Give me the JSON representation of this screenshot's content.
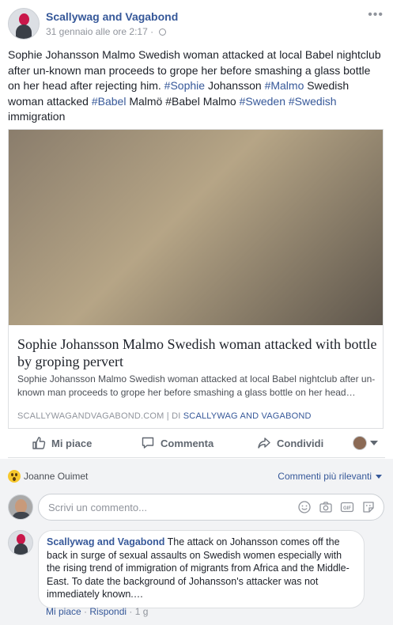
{
  "post": {
    "page_name": "Scallywag and Vagabond",
    "timestamp": "31 gennaio alle ore 2:17",
    "separator": "·",
    "more": "•••",
    "text": {
      "t1": "Sophie Johansson Malmo Swedish woman attacked at local Babel nightclub after un-known man proceeds to grope her before smashing a glass bottle on her head after rejecting him. ",
      "h1": "#Sophie",
      "t2": " Johansson ",
      "h2": "#Malmo",
      "t3": " Swedish woman attacked ",
      "h3": "#Babel",
      "t4": " Malmö #Babel Malmo ",
      "h4": "#Sweden",
      "t5": " ",
      "h5": "#Swedish",
      "t6": " immigration"
    }
  },
  "link_card": {
    "title": "Sophie Johansson Malmo Swedish woman attacked with bottle by groping pervert",
    "description": "Sophie Johansson Malmo Swedish woman attacked at local Babel nightclub after un-known man proceeds to grope her before smashing a glass bottle on her head…",
    "domain": "SCALLYWAGANDVAGABOND.COM",
    "divider": " | DI ",
    "author": "SCALLYWAG AND VAGABOND"
  },
  "actions": {
    "like": "Mi piace",
    "comment": "Commenta",
    "share": "Condividi"
  },
  "reactions": {
    "reactor": "Joanne Ouimet",
    "sort_label": "Commenti più rilevanti"
  },
  "comment_input": {
    "placeholder": "Scrivi un commento..."
  },
  "comment": {
    "author": "Scallywag and Vagabond",
    "text": " The attack on Johansson comes off the back in surge of sexual assaults on Swedish women especially with the rising trend of immigration of migrants from Africa and the Middle-East. To date the background of Johansson's attacker was not immediately known.…",
    "like": "Mi piace",
    "sep": " · ",
    "reply": "Rispondi",
    "age": "1 g"
  },
  "colors": {
    "link": "#365899",
    "meta": "#90949c",
    "text": "#1d2129"
  },
  "icons": [
    "more-icon",
    "globe-icon",
    "like-icon",
    "comment-icon",
    "share-icon",
    "wow-reaction-icon",
    "emoji-icon",
    "camera-icon",
    "gif-icon",
    "sticker-icon"
  ]
}
